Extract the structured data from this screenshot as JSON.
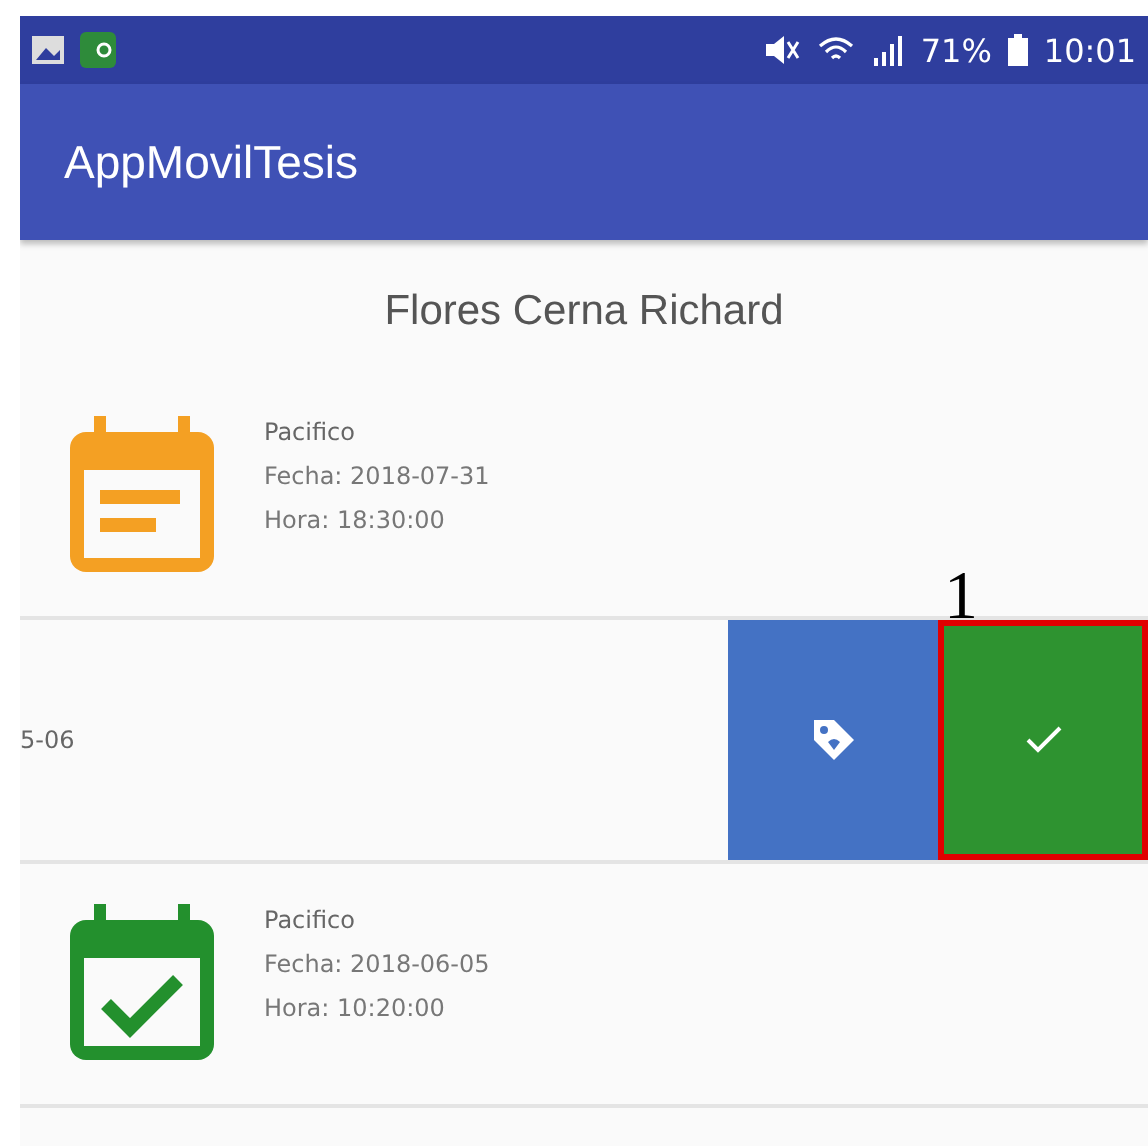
{
  "status_bar": {
    "battery": "71%",
    "time": "10:01"
  },
  "app_bar": {
    "title": "AppMovilTesis"
  },
  "header": "Flores Cerna Richard",
  "items": [
    {
      "kind": "pending",
      "place": "Pacifico",
      "date": "Fecha: 2018-07-31",
      "time": "Hora: 18:30:00"
    },
    {
      "kind": "swiped",
      "text": "5-06",
      "actions": [
        {
          "kind": "tag",
          "highlighted": false
        },
        {
          "kind": "confirm",
          "highlighted": true
        }
      ]
    },
    {
      "kind": "done",
      "place": "Pacifico",
      "date": "Fecha: 2018-06-05",
      "time": "Hora: 10:20:00"
    }
  ],
  "annotation": "1"
}
